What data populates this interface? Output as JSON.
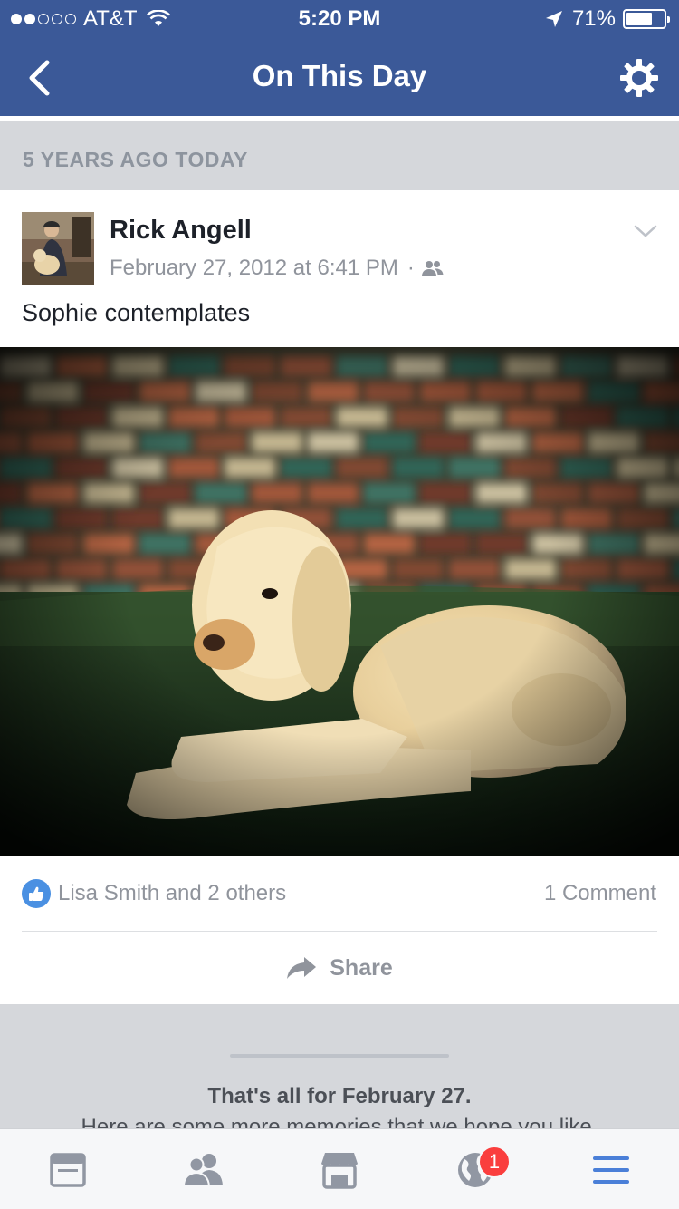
{
  "status_bar": {
    "carrier": "AT&T",
    "time": "5:20 PM",
    "battery": "71%",
    "battery_level": 0.71,
    "signal_bars_on": 2,
    "signal_bars_total": 5
  },
  "nav": {
    "title": "On This Day",
    "back_icon": "chevron-left-icon",
    "settings_icon": "gear-icon"
  },
  "section_header": "5 YEARS AGO TODAY",
  "post": {
    "author": "Rick Angell",
    "timestamp": "February 27, 2012 at 6:41 PM",
    "separator": "·",
    "audience_icon": "friends-icon",
    "text": "Sophie contemplates",
    "likes": "Lisa Smith and 2 others",
    "comments": "1 Comment",
    "share_label": "Share"
  },
  "end": {
    "title": "That's all for February 27.",
    "subtitle": "Here are some more memories that we hope you like."
  },
  "tab_bar": {
    "notification_count": "1",
    "tabs": [
      "news-feed-icon",
      "friends-icon",
      "marketplace-icon",
      "notifications-globe-icon",
      "menu-icon"
    ]
  },
  "colors": {
    "brand": "#3b5998",
    "badge": "#fa3e3e",
    "like": "#4a90e2",
    "active_tab": "#4a7fd8"
  }
}
